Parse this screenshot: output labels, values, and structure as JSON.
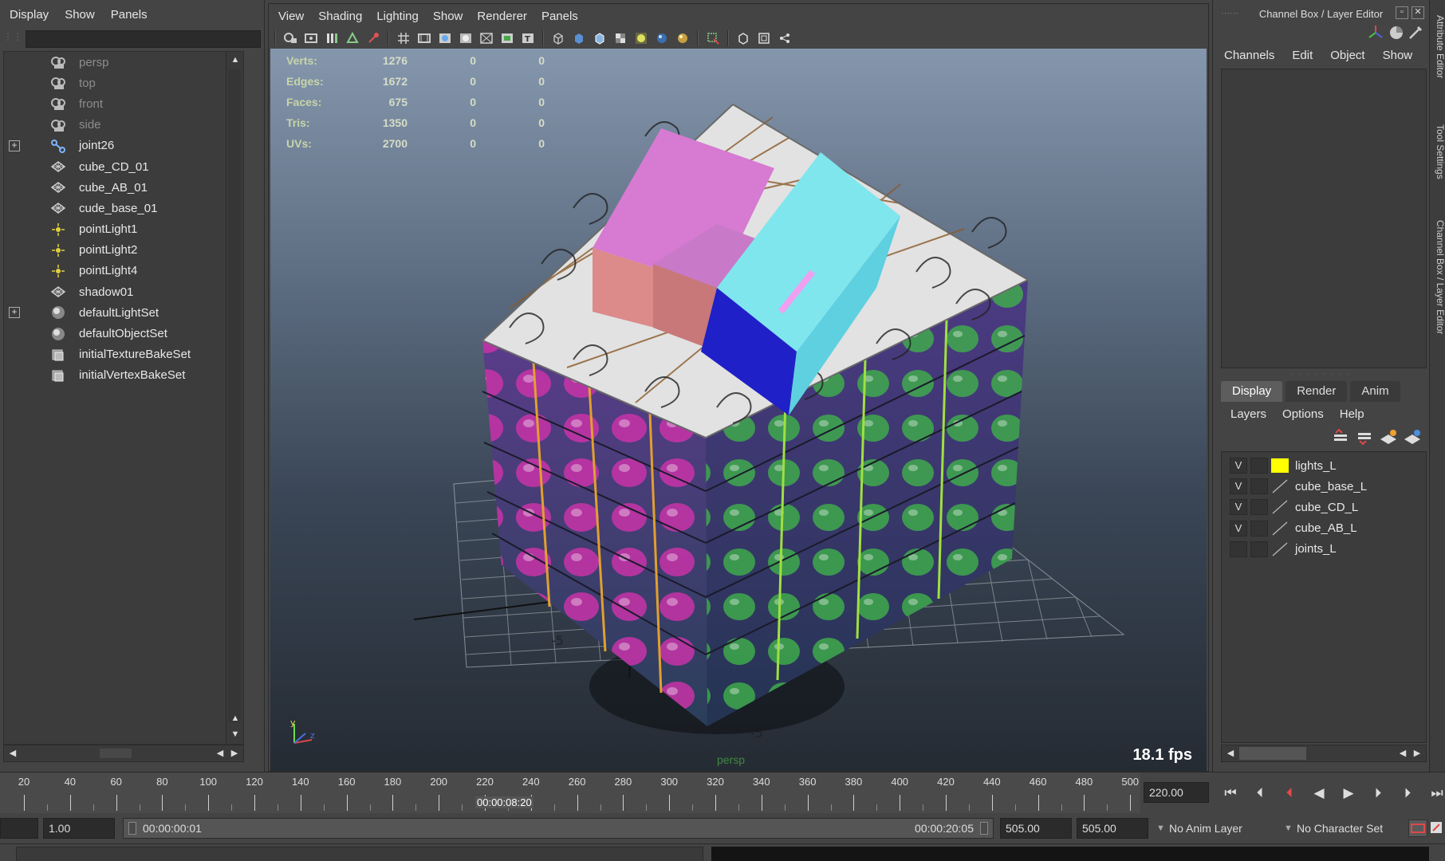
{
  "outliner": {
    "menu": [
      "Display",
      "Show",
      "Panels"
    ],
    "search": {
      "value": "",
      "placeholder": ""
    },
    "items": [
      {
        "label": "persp",
        "icon": "camera-icon",
        "dim": true
      },
      {
        "label": "top",
        "icon": "camera-icon",
        "dim": true
      },
      {
        "label": "front",
        "icon": "camera-icon",
        "dim": true
      },
      {
        "label": "side",
        "icon": "camera-icon",
        "dim": true
      },
      {
        "label": "joint26",
        "icon": "joint-icon",
        "expand": "+"
      },
      {
        "label": "cube_CD_01",
        "icon": "mesh-icon"
      },
      {
        "label": "cube_AB_01",
        "icon": "mesh-icon"
      },
      {
        "label": "cude_base_01",
        "icon": "mesh-icon"
      },
      {
        "label": "pointLight1",
        "icon": "point-light-icon"
      },
      {
        "label": "pointLight2",
        "icon": "point-light-icon"
      },
      {
        "label": "pointLight4",
        "icon": "point-light-icon"
      },
      {
        "label": "shadow01",
        "icon": "mesh-icon"
      },
      {
        "label": "defaultLightSet",
        "icon": "set-icon",
        "expand": "+"
      },
      {
        "label": "defaultObjectSet",
        "icon": "set-icon"
      },
      {
        "label": "initialTextureBakeSet",
        "icon": "bake-set-icon"
      },
      {
        "label": "initialVertexBakeSet",
        "icon": "bake-set-icon"
      }
    ]
  },
  "viewport": {
    "menu": [
      "View",
      "Shading",
      "Lighting",
      "Show",
      "Renderer",
      "Panels"
    ],
    "hud": [
      {
        "key": "Verts:",
        "values": [
          "1276",
          "0",
          "0"
        ]
      },
      {
        "key": "Edges:",
        "values": [
          "1672",
          "0",
          "0"
        ]
      },
      {
        "key": "Faces:",
        "values": [
          "675",
          "0",
          "0"
        ]
      },
      {
        "key": "Tris:",
        "values": [
          "1350",
          "0",
          "0"
        ]
      },
      {
        "key": "UVs:",
        "values": [
          "2700",
          "0",
          "0"
        ]
      }
    ],
    "fps": "18.1 fps",
    "camera": "persp",
    "axis": {
      "y": "y",
      "x": "x",
      "z": "z"
    },
    "grid_labels": [
      "5",
      "0",
      "-5",
      "5",
      "-5"
    ]
  },
  "right_panel": {
    "title": "Channel Box / Layer Editor",
    "cb_menu": [
      "Channels",
      "Edit",
      "Object",
      "Show"
    ],
    "tabs": [
      "Display",
      "Render",
      "Anim"
    ],
    "active_tab": "Display",
    "layer_menu": [
      "Layers",
      "Options",
      "Help"
    ],
    "layers": [
      {
        "visible": "V",
        "name": "lights_L",
        "color": "#ffff00"
      },
      {
        "visible": "V",
        "name": "cube_base_L",
        "color": ""
      },
      {
        "visible": "V",
        "name": "cube_CD_L",
        "color": ""
      },
      {
        "visible": "V",
        "name": "cube_AB_L",
        "color": ""
      },
      {
        "visible": "",
        "name": "joints_L",
        "color": ""
      }
    ],
    "side_tabs": [
      "Attribute Editor",
      "Tool Settings",
      "Channel Box / Layer Editor"
    ]
  },
  "timeslider": {
    "ticks": [
      "20",
      "40",
      "60",
      "80",
      "100",
      "120",
      "140",
      "160",
      "180",
      "200",
      "220",
      "240",
      "260",
      "280",
      "300",
      "320",
      "340",
      "360",
      "380",
      "400",
      "420",
      "440",
      "460",
      "480",
      "500"
    ],
    "current_time": "00:00:08:20",
    "current_frame": "220.00"
  },
  "rangeslider": {
    "start_field": "1.00",
    "range_start": "00:00:00:01",
    "range_end": "00:00:20:05",
    "end_field_1": "505.00",
    "end_field_2": "505.00",
    "anim_layer": "No Anim Layer",
    "character_set": "No Character Set"
  }
}
